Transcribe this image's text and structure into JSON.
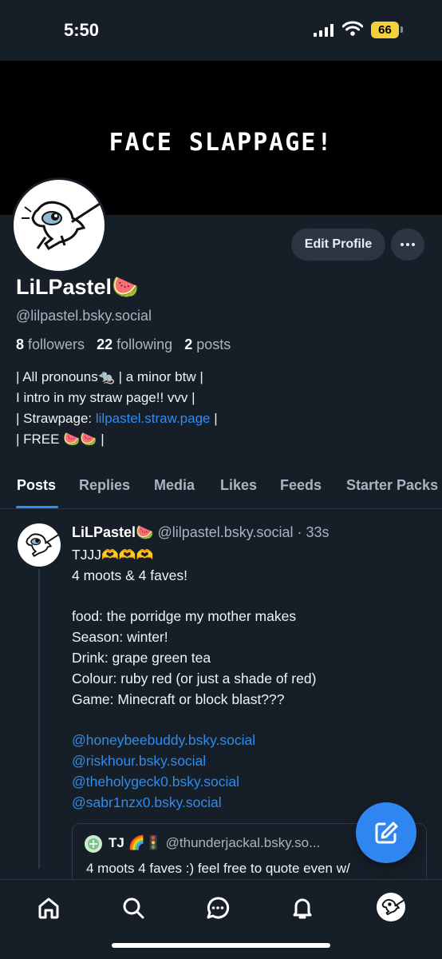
{
  "status_bar": {
    "time": "5:50",
    "battery": "66"
  },
  "banner": {
    "text": "FACE SLAPPAGE!"
  },
  "profile": {
    "edit_label": "Edit Profile",
    "display_name": "LiLPastel",
    "name_emoji": "🍉",
    "handle": "@lilpastel.bsky.social",
    "followers_count": "8",
    "followers_label": "followers",
    "following_count": "22",
    "following_label": "following",
    "posts_count": "2",
    "posts_label": "posts",
    "bio": {
      "line1": "| All pronouns🐀 | a minor btw |",
      "line2": "I intro in my straw page!! vvv |",
      "line3_prefix": "| Strawpage: ",
      "line3_link": "lilpastel.straw.page",
      "line3_suffix": " |",
      "line4": "| FREE 🍉🍉 |"
    }
  },
  "tabs": [
    "Posts",
    "Replies",
    "Media",
    "Likes",
    "Feeds",
    "Starter Packs"
  ],
  "post": {
    "author": "LiLPastel🍉",
    "handle_time": "@lilpastel.bsky.social · 33s",
    "lines": [
      "TJJJ🫶🫶🫶",
      "4 moots & 4 faves!",
      "",
      "food: the porridge my mother makes",
      "Season: winter!",
      "Drink: grape green tea",
      "Colour: ruby red (or just a shade of red)",
      "Game: Minecraft or block blast???",
      ""
    ],
    "mentions": [
      "@honeybeebuddy.bsky.social",
      "@riskhour.bsky.social",
      "@theholygeck0.bsky.social",
      "@sabr1nzx0.bsky.social"
    ],
    "quote": {
      "author": "TJ 🌈🚦",
      "handle": "@thunderjackal.bsky.so...",
      "text": "4 moots 4 faves :) feel free to quote even w/"
    }
  },
  "colors": {
    "background": "#161e27",
    "accent": "#2f8cf0",
    "button": "#2b3642",
    "battery": "#f4d03a"
  },
  "icons": {
    "nav": [
      "home-icon",
      "search-icon",
      "chat-icon",
      "bell-icon",
      "profile-avatar"
    ],
    "fab": "compose-icon"
  }
}
